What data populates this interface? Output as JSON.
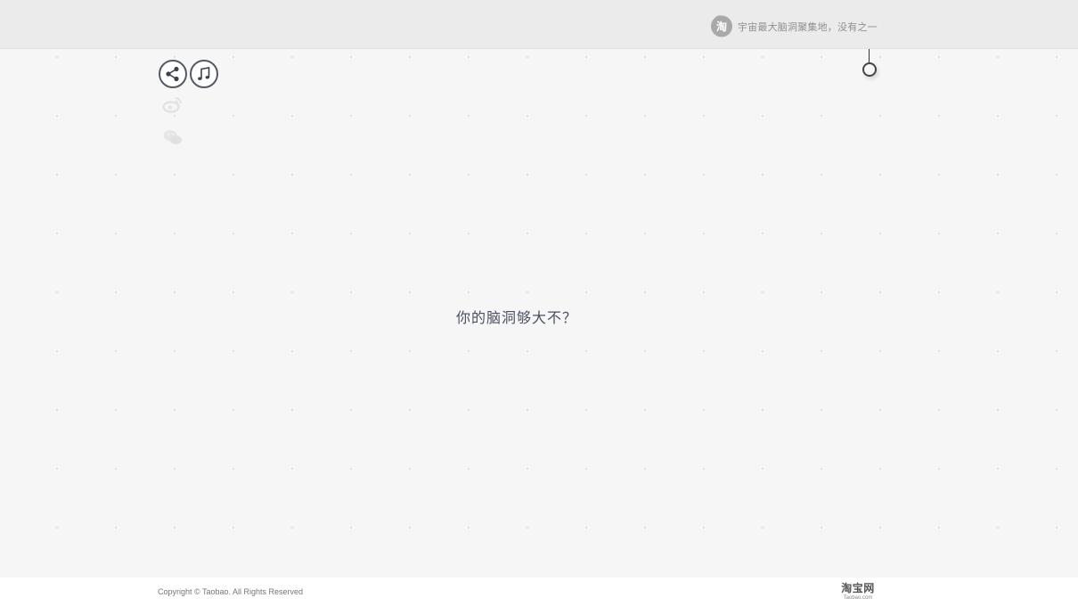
{
  "header": {
    "logo_char": "淘",
    "slogan": "宇宙最大脑洞聚集地，没有之一"
  },
  "toolbar": {
    "share_icon": "share-icon",
    "music_icon": "music-note-icon",
    "weibo_icon": "weibo-icon",
    "wechat_icon": "wechat-icon"
  },
  "main": {
    "question": "你的脑洞够大不？"
  },
  "footer": {
    "copyright": "Copyright © Taobao. All Rights Reserved",
    "brand_cn": "淘宝网",
    "brand_en": "Taobao.com"
  },
  "colors": {
    "background": "#f6f6f6",
    "header": "#ebebeb",
    "icon_stroke": "#555a62",
    "question_text": "#4a5060"
  }
}
